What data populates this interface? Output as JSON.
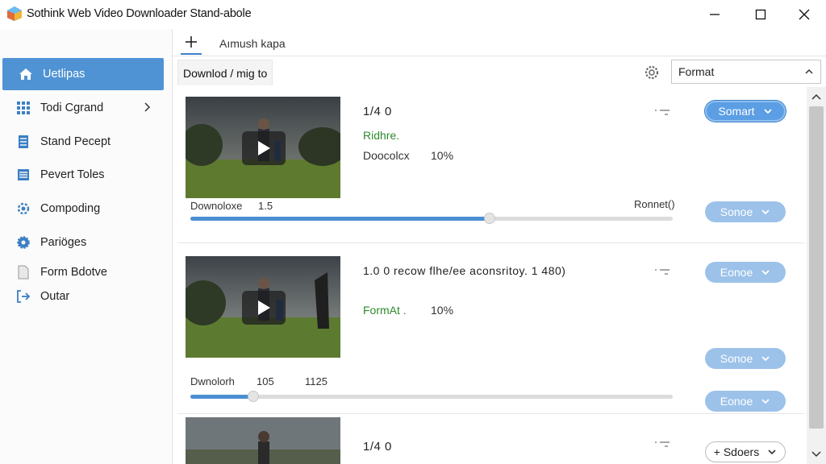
{
  "window": {
    "title": "Sothink Web Video Downloader Stand-abole"
  },
  "sidebar": {
    "items": [
      {
        "label": "Uetlipas",
        "icon": "home-icon",
        "active": true
      },
      {
        "label": "Todi Cgrand",
        "icon": "grid-icon",
        "has_chevron": true
      },
      {
        "label": "Stand Pecept",
        "icon": "document-icon"
      },
      {
        "label": "Pevert Toles",
        "icon": "list-icon"
      },
      {
        "label": "Compoding",
        "icon": "refresh-gear-icon"
      },
      {
        "label": "Pariöges",
        "icon": "gear-icon"
      },
      {
        "label": "Form Bdotve",
        "icon": "file-icon"
      },
      {
        "label": "Outar",
        "icon": "exit-icon"
      }
    ]
  },
  "tabs": {
    "add_label": "+",
    "current": "Aımush kapa"
  },
  "toolbar": {
    "subtab": "Downlod / mig to",
    "format_label": "Format"
  },
  "items": [
    {
      "title": "1/4 0",
      "line1_green": "Ridhre.",
      "line2_label": "Doocolcx",
      "line2_value": "10%",
      "button1": "Somart",
      "button2": "Sonoe",
      "dl_label": "Downoloxe",
      "dl_value": "1.5",
      "right_label": "Ronnet()",
      "progress": 0.62
    },
    {
      "title": "1.0 0  recow flhe/ee aconsritoy.  1 480)",
      "line1_green": "FormAt .",
      "line1_value": "10%",
      "button1": "Eonoe",
      "button2": "Sonoe",
      "button3": "Eonoe",
      "dl_label": "Dwnolorh",
      "dl_value": "105",
      "dl_value2": "1125",
      "progress": 0.13
    },
    {
      "title": "1/4 0",
      "button1": "+ Sdoers"
    }
  ],
  "colors": {
    "accent": "#4f93d4",
    "green": "#2d8a2d",
    "pill": "#9cc2ea"
  }
}
